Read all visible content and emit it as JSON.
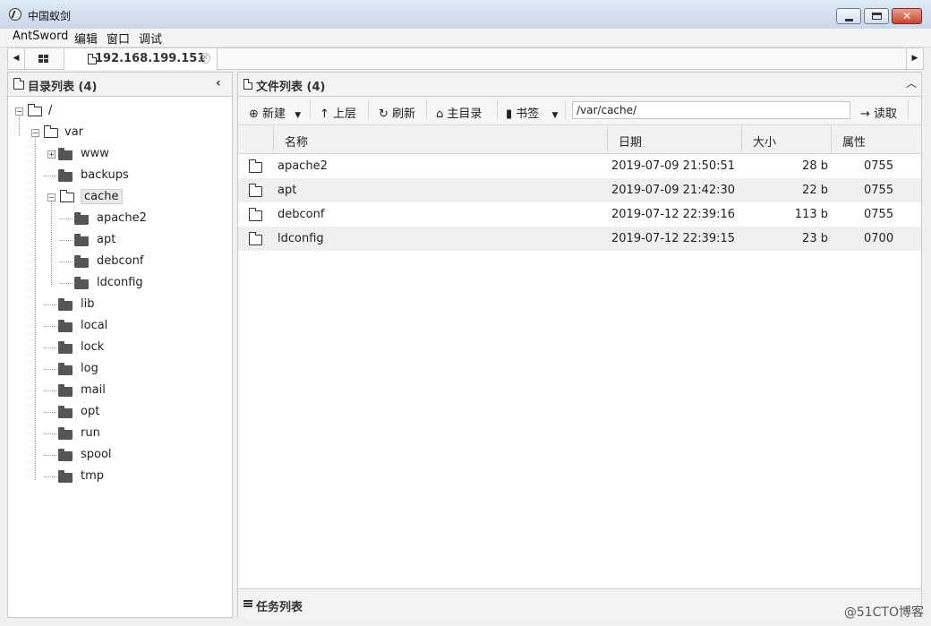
{
  "window": {
    "title": "中国蚁剑"
  },
  "menu": [
    "AntSword",
    "编辑",
    "窗口",
    "调试"
  ],
  "tabs": {
    "connection": "192.168.199.151"
  },
  "left_panel": {
    "title": "目录列表 (4)",
    "tree": [
      {
        "label": "/",
        "depth": 0,
        "expanded": true,
        "open": true
      },
      {
        "label": "var",
        "depth": 1,
        "expanded": true,
        "open": true
      },
      {
        "label": "www",
        "depth": 2,
        "toggle": "plus"
      },
      {
        "label": "backups",
        "depth": 2
      },
      {
        "label": "cache",
        "depth": 2,
        "expanded": true,
        "open": true,
        "selected": true
      },
      {
        "label": "apache2",
        "depth": 3
      },
      {
        "label": "apt",
        "depth": 3
      },
      {
        "label": "debconf",
        "depth": 3
      },
      {
        "label": "ldconfig",
        "depth": 3
      },
      {
        "label": "lib",
        "depth": 2
      },
      {
        "label": "local",
        "depth": 2
      },
      {
        "label": "lock",
        "depth": 2
      },
      {
        "label": "log",
        "depth": 2
      },
      {
        "label": "mail",
        "depth": 2
      },
      {
        "label": "opt",
        "depth": 2
      },
      {
        "label": "run",
        "depth": 2
      },
      {
        "label": "spool",
        "depth": 2
      },
      {
        "label": "tmp",
        "depth": 2
      }
    ]
  },
  "right_panel": {
    "title": "文件列表 (4)",
    "toolbar": {
      "new": "新建",
      "up": "上层",
      "refresh": "刷新",
      "home": "主目录",
      "bookmark": "书签",
      "path": "/var/cache/",
      "read": "读取"
    },
    "columns": [
      "名称",
      "日期",
      "大小",
      "属性"
    ],
    "rows": [
      {
        "name": "apache2",
        "date": "2019-07-09 21:50:51",
        "size": "28 b",
        "attr": "0755"
      },
      {
        "name": "apt",
        "date": "2019-07-09 21:42:30",
        "size": "22 b",
        "attr": "0755"
      },
      {
        "name": "debconf",
        "date": "2019-07-12 22:39:16",
        "size": "113 b",
        "attr": "0755"
      },
      {
        "name": "ldconfig",
        "date": "2019-07-12 22:39:15",
        "size": "23 b",
        "attr": "0700"
      }
    ],
    "task_panel": "任务列表"
  },
  "watermark": "@51CTO博客"
}
